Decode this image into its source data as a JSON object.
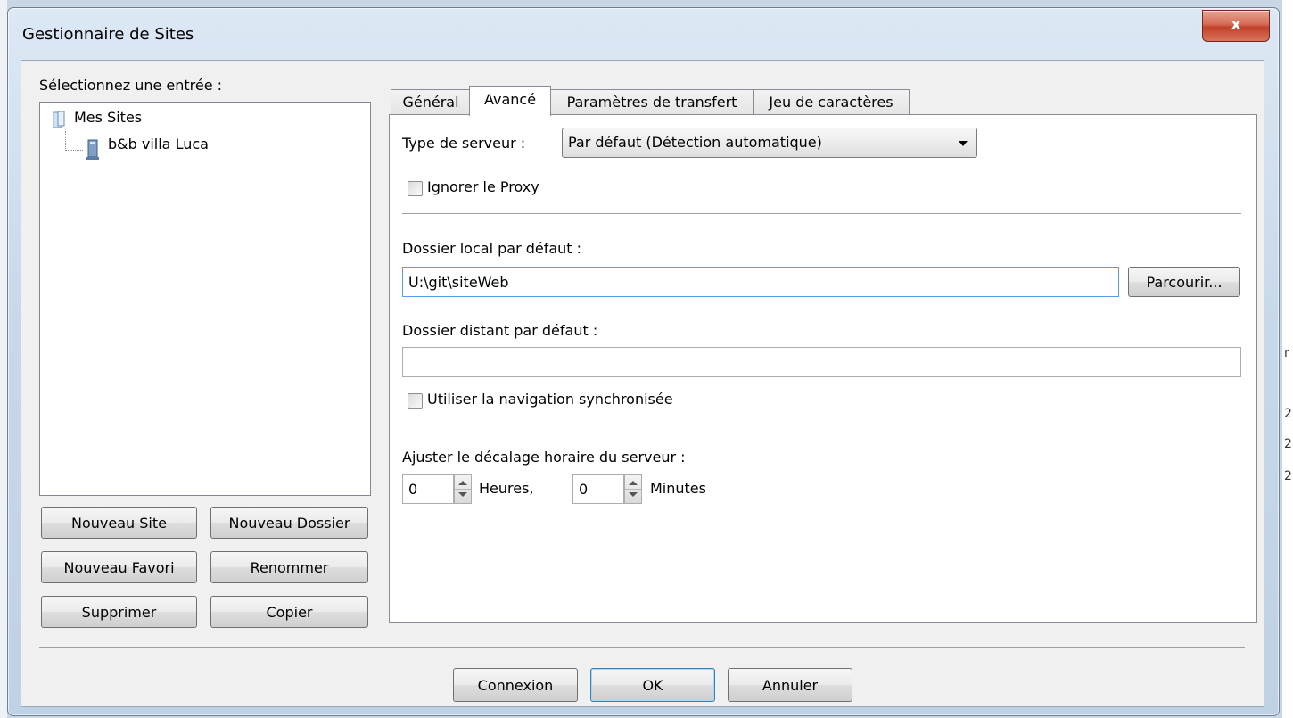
{
  "window": {
    "title": "Gestionnaire de Sites",
    "close_label": "x"
  },
  "left": {
    "prompt": "Sélectionnez une entrée :",
    "tree": {
      "root": "Mes Sites",
      "child": "b&b villa Luca"
    },
    "buttons": {
      "new_site": "Nouveau Site",
      "new_folder": "Nouveau Dossier",
      "new_favorite": "Nouveau Favori",
      "rename": "Renommer",
      "delete": "Supprimer",
      "copy": "Copier"
    }
  },
  "tabs": [
    {
      "label": "Général"
    },
    {
      "label": "Avancé"
    },
    {
      "label": "Paramètres de transfert"
    },
    {
      "label": "Jeu de caractères"
    }
  ],
  "advanced": {
    "server_type_label": "Type de serveur :",
    "server_type_value": "Par défaut (Détection automatique)",
    "bypass_proxy_label": "Ignorer le Proxy",
    "local_dir_label": "Dossier local par défaut :",
    "local_dir_value": "U:\\git\\siteWeb",
    "browse_label": "Parcourir...",
    "remote_dir_label": "Dossier distant par défaut :",
    "remote_dir_value": "",
    "sync_browsing_label": "Utiliser la navigation synchronisée",
    "timezone_label": "Ajuster le décalage horaire du serveur :",
    "hours_value": "0",
    "hours_unit": "Heures,",
    "minutes_value": "0",
    "minutes_unit": "Minutes"
  },
  "footer": {
    "connect": "Connexion",
    "ok": "OK",
    "cancel": "Annuler"
  },
  "background_fragments": [
    "r",
    "2",
    "2",
    "2"
  ]
}
